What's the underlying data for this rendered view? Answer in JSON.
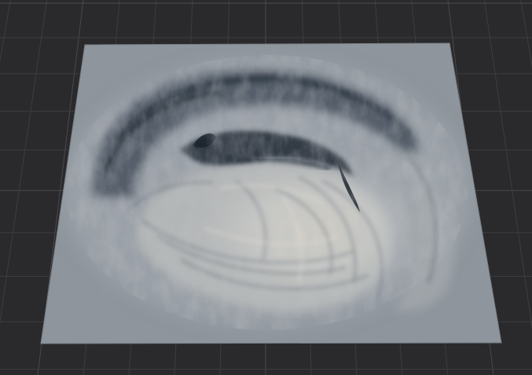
{
  "viewport": {
    "name": "3d-viewport",
    "background_color": "#2a2a2c",
    "grid_color": "#3d3d40",
    "grid_major_color": "#49494d"
  },
  "terrain": {
    "name": "terrain-heightmap-mesh",
    "plane_color": "#8e959c",
    "shadow_color": "#2f3845",
    "highlight_color": "#ddd8cc",
    "midtone_color": "#aab0b6",
    "feature": "swirling-vortex-terrain"
  }
}
